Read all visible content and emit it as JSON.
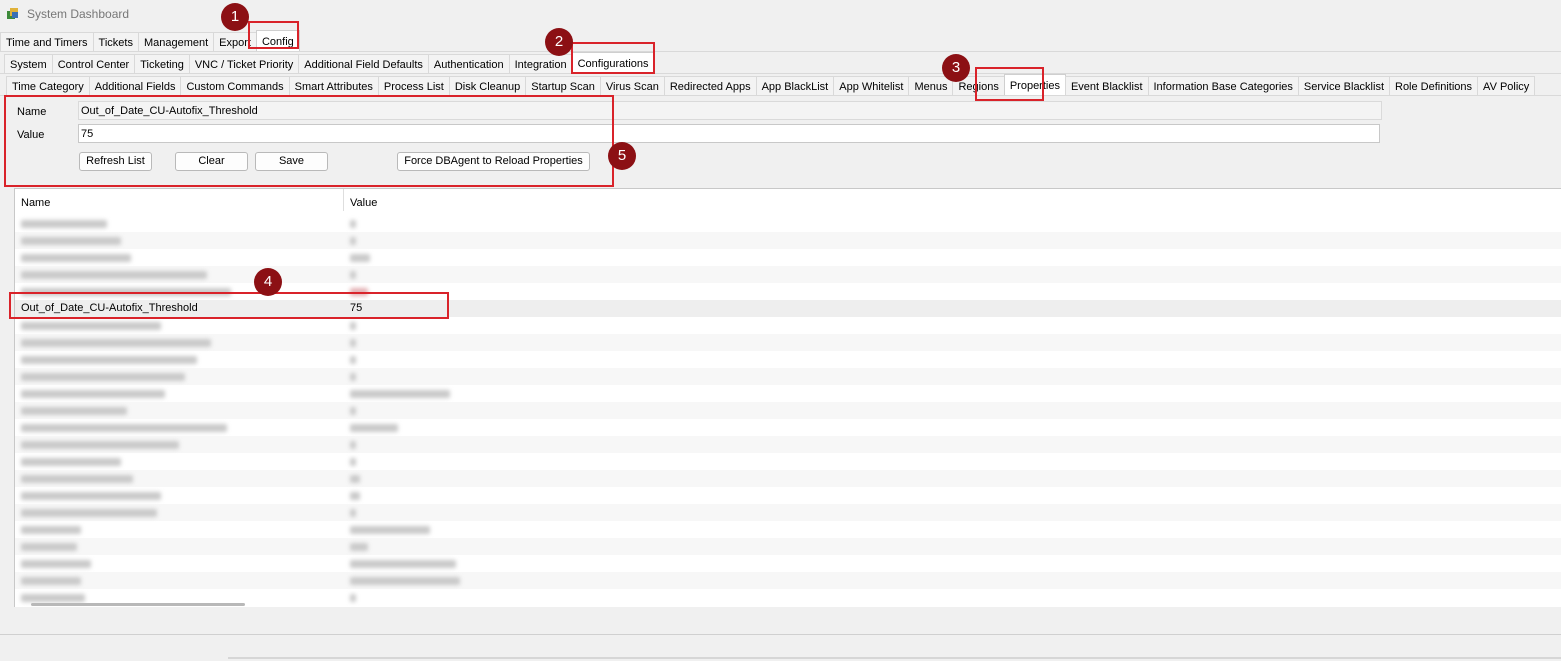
{
  "window": {
    "title": "System Dashboard",
    "icon": "app-icon"
  },
  "tabs_main": [
    {
      "label": "Time and Timers"
    },
    {
      "label": "Tickets"
    },
    {
      "label": "Management"
    },
    {
      "label": "Export"
    },
    {
      "label": "Config"
    }
  ],
  "tabs_config": [
    {
      "label": "System"
    },
    {
      "label": "Control Center"
    },
    {
      "label": "Ticketing"
    },
    {
      "label": "VNC / Ticket Priority"
    },
    {
      "label": "Additional Field Defaults"
    },
    {
      "label": "Authentication"
    },
    {
      "label": "Integration"
    },
    {
      "label": "Configurations"
    }
  ],
  "tabs_sub": [
    {
      "label": "Time Category"
    },
    {
      "label": "Additional Fields"
    },
    {
      "label": "Custom Commands"
    },
    {
      "label": "Smart Attributes"
    },
    {
      "label": "Process List"
    },
    {
      "label": "Disk Cleanup"
    },
    {
      "label": "Startup Scan"
    },
    {
      "label": "Virus Scan"
    },
    {
      "label": "Redirected Apps"
    },
    {
      "label": "App BlackList"
    },
    {
      "label": "App Whitelist"
    },
    {
      "label": "Menus"
    },
    {
      "label": "Regions"
    },
    {
      "label": "Properties"
    },
    {
      "label": "Event Blacklist"
    },
    {
      "label": "Information Base Categories"
    },
    {
      "label": "Service Blacklist"
    },
    {
      "label": "Role Definitions"
    },
    {
      "label": "AV Policy"
    }
  ],
  "form": {
    "name_label": "Name",
    "name_value": "Out_of_Date_CU-Autofix_Threshold",
    "value_label": "Value",
    "value_value": "75",
    "refresh_label": "Refresh List",
    "clear_label": "Clear",
    "save_label": "Save",
    "force_label": "Force DBAgent to Reload Properties"
  },
  "table": {
    "col_name": "Name",
    "col_value": "Value",
    "selected_row": {
      "name": "Out_of_Date_CU-Autofix_Threshold",
      "value": "75"
    }
  },
  "annotations": [
    "1",
    "2",
    "3",
    "4",
    "5"
  ],
  "colors": {
    "highlight": "#d9232a",
    "badge": "#8c1014"
  }
}
